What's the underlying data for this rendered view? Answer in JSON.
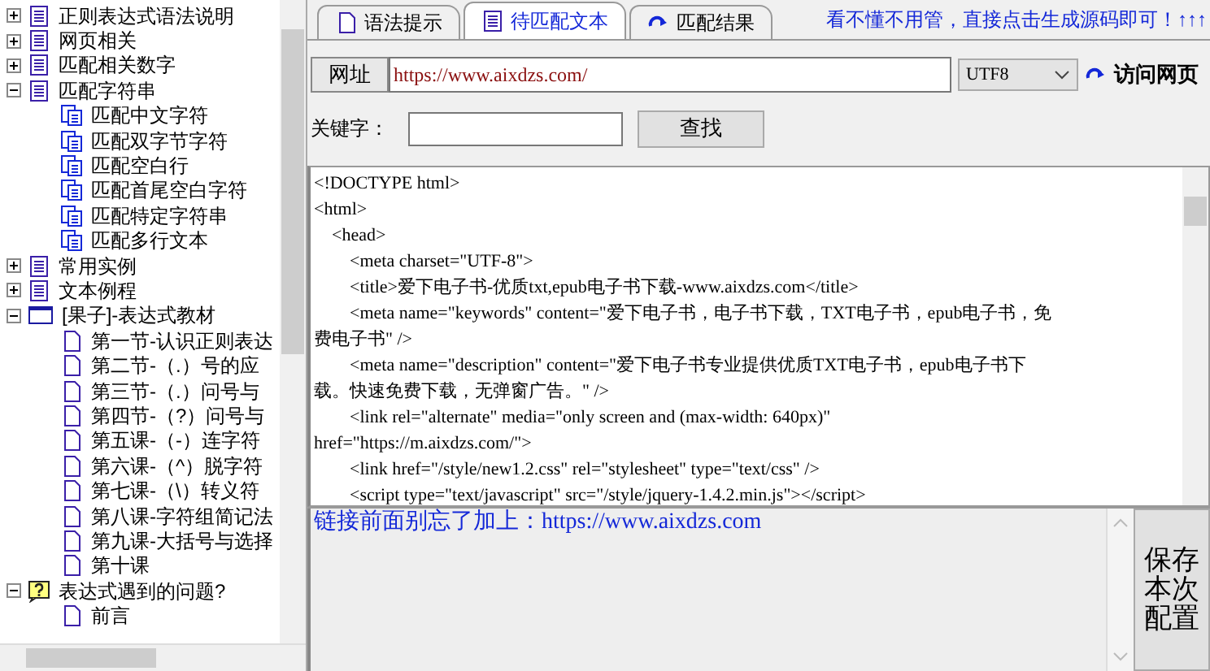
{
  "tree": [
    {
      "label": "正则表达式语法说明",
      "kind": "book",
      "expanded": false
    },
    {
      "label": "网页相关",
      "kind": "book",
      "expanded": false
    },
    {
      "label": "匹配相关数字",
      "kind": "book",
      "expanded": false
    },
    {
      "label": "匹配字符串",
      "kind": "book",
      "expanded": true,
      "children": [
        {
          "label": "匹配中文字符",
          "kind": "pages"
        },
        {
          "label": "匹配双字节字符",
          "kind": "pages"
        },
        {
          "label": "匹配空白行",
          "kind": "pages"
        },
        {
          "label": "匹配首尾空白字符",
          "kind": "pages"
        },
        {
          "label": "匹配特定字符串",
          "kind": "pages"
        },
        {
          "label": "匹配多行文本",
          "kind": "pages"
        }
      ]
    },
    {
      "label": "常用实例",
      "kind": "book",
      "expanded": false
    },
    {
      "label": "文本例程",
      "kind": "book",
      "expanded": false
    },
    {
      "label": "[果子]-表达式教材",
      "kind": "window",
      "expanded": true,
      "children": [
        {
          "label": "第一节-认识正则表达",
          "kind": "page"
        },
        {
          "label": "第二节-（.）号的应",
          "kind": "page"
        },
        {
          "label": "第三节-（.）问号与",
          "kind": "page"
        },
        {
          "label": "第四节-（?）问号与",
          "kind": "page"
        },
        {
          "label": "第五课-（-）连字符",
          "kind": "page"
        },
        {
          "label": "第六课-（^）脱字符",
          "kind": "page"
        },
        {
          "label": "第七课-（\\）转义符",
          "kind": "page"
        },
        {
          "label": "第八课-字符组简记法",
          "kind": "page"
        },
        {
          "label": "第九课-大括号与选择",
          "kind": "page"
        },
        {
          "label": "第十课",
          "kind": "page"
        }
      ]
    },
    {
      "label": "表达式遇到的问题?",
      "kind": "help",
      "expanded": true,
      "children": [
        {
          "label": "前言",
          "kind": "page"
        }
      ]
    }
  ],
  "tabs": [
    {
      "label": "语法提示",
      "kind": "page",
      "selected": false
    },
    {
      "label": "待匹配文本",
      "kind": "book",
      "selected": true
    },
    {
      "label": "匹配结果",
      "kind": "arrow",
      "selected": false
    }
  ],
  "hint": "看不懂不用管，直接点击生成源码即可！↑↑↑",
  "address": {
    "label": "网址",
    "value": "https://www.aixdzs.com/"
  },
  "encoding": {
    "value": "UTF8"
  },
  "visit_button": "访问网页",
  "keyword": {
    "label": "关键字："
  },
  "search_button": "查找",
  "source_lines": [
    "<!DOCTYPE html>",
    "<html>",
    "    <head>",
    "        <meta charset=\"UTF-8\">",
    "        <title>爱下电子书-优质txt,epub电子书下载-www.aixdzs.com</title>",
    "        <meta name=\"keywords\" content=\"爱下电子书，电子书下载，TXT电子书，epub电子书，免",
    "费电子书\" />",
    "        <meta name=\"description\" content=\"爱下电子书专业提供优质TXT电子书，epub电子书下",
    "载。快速免费下载，无弹窗广告。\" />",
    "        <link rel=\"alternate\" media=\"only screen and (max-width: 640px)\"",
    "href=\"https://m.aixdzs.com/\">",
    "        <link href=\"/style/new1.2.css\" rel=\"stylesheet\" type=\"text/css\" />",
    "        <script type=\"text/javascript\" src=\"/style/jquery-1.4.2.min.js\"></script>"
  ],
  "note": "链接前面别忘了加上：https://www.aixdzs.com",
  "save_button": "保存本次配置"
}
